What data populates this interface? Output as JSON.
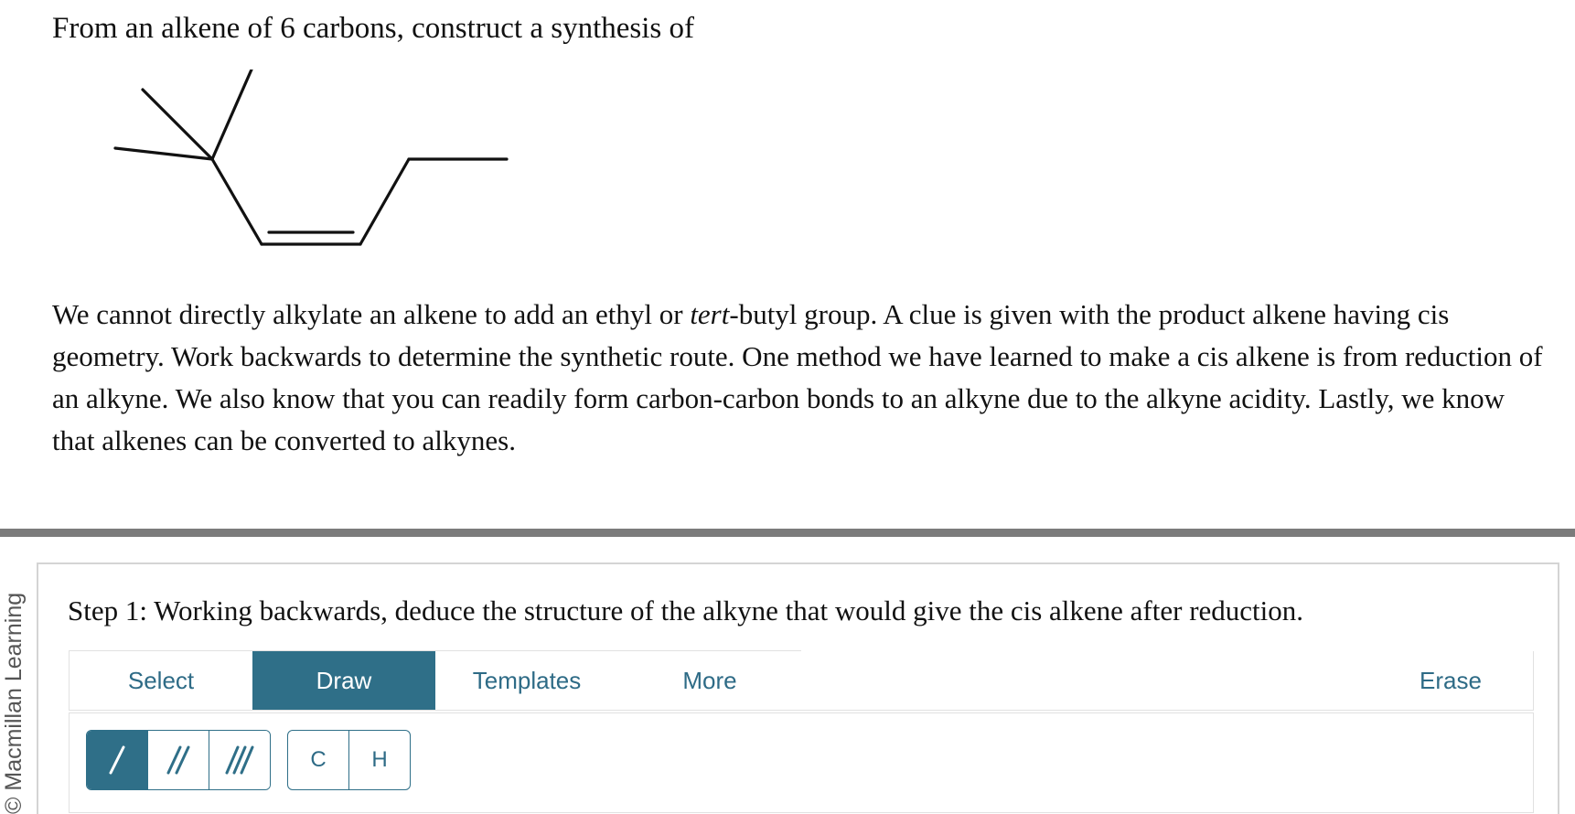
{
  "question": {
    "title": "From an alkene of 6 carbons, construct a synthesis of",
    "explanation": {
      "part1": "We cannot directly alkylate an alkene to add an ethyl or ",
      "italic": "tert",
      "part2": "-butyl group. A clue is given with the product alkene having cis geometry. Work backwards to determine the synthetic route. One method we have learned to make a cis alkene is from reduction of an alkyne. We also know that you can readily form carbon-carbon bonds to an alkyne due to the alkyne acidity. Lastly, we know that alkenes can be converted to alkynes."
    }
  },
  "copyright": "© Macmillan Learning",
  "step": {
    "heading": "Step 1: Working backwards, deduce the structure of the alkyne that would give the cis alkene after reduction."
  },
  "toolbar": {
    "tabs": {
      "select": "Select",
      "draw": "Draw",
      "templates": "Templates",
      "more": "More",
      "erase": "Erase"
    },
    "active_tab": "Draw"
  },
  "tools": {
    "bonds": [
      "single-bond-icon",
      "double-bond-icon",
      "triple-bond-icon"
    ],
    "active_bond": "single-bond-icon",
    "atoms": {
      "carbon": "C",
      "hydrogen": "H"
    }
  },
  "colors": {
    "accent": "#2f6f88",
    "accent_text": "#2e6b86",
    "divider": "#7b7b7b"
  }
}
